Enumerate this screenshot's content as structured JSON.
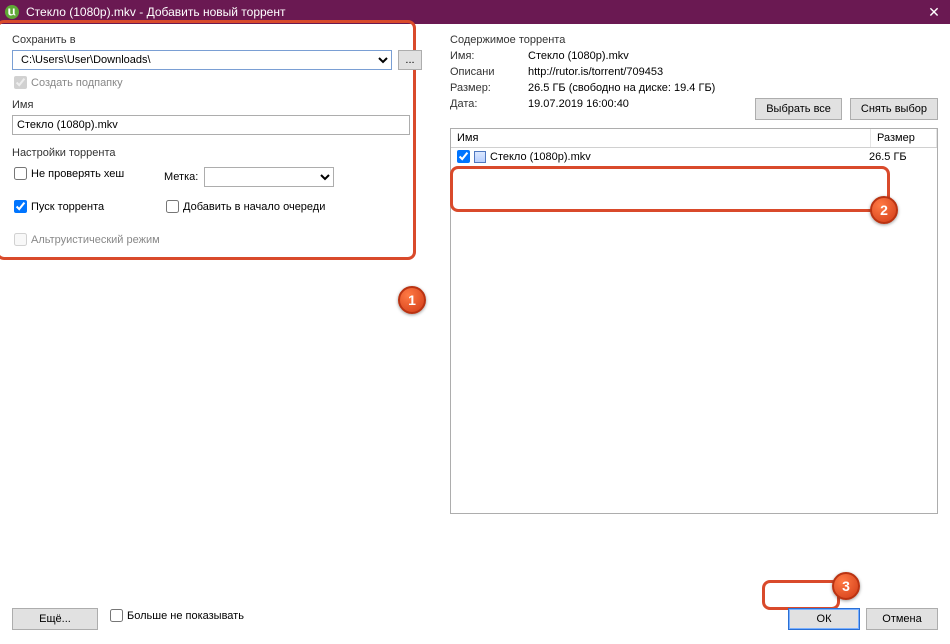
{
  "titlebar": {
    "title": "Стекло (1080p).mkv - Добавить новый торрент",
    "close": "✕"
  },
  "left": {
    "save_in_label": "Сохранить в",
    "path_value": "C:\\Users\\User\\Downloads\\",
    "browse": "...",
    "create_subfolder": "Создать подпапку",
    "name_label": "Имя",
    "name_value": "Стекло (1080p).mkv",
    "torrent_settings_label": "Настройки торрента",
    "skip_hash": "Не проверять хеш",
    "start_torrent": "Пуск торрента",
    "altruistic": "Альтруистический режим",
    "label_label": "Метка:",
    "add_to_top": "Добавить в начало очереди"
  },
  "right": {
    "contents_label": "Содержимое торрента",
    "name_l": "Имя:",
    "name_v": "Стекло (1080p).mkv",
    "desc_l": "Описани",
    "desc_v": "http://rutor.is/torrent/709453",
    "size_l": "Размер:",
    "size_v": "26.5 ГБ (свободно на диске: 19.4 ГБ)",
    "date_l": "Дата:",
    "date_v": "19.07.2019 16:00:40",
    "select_all": "Выбрать все",
    "deselect": "Снять выбор",
    "col_name": "Имя",
    "col_size": "Размер",
    "file_name": "Стекло (1080p).mkv",
    "file_size": "26.5 ГБ"
  },
  "bottom": {
    "more": "Ещё...",
    "dont_show": "Больше не показывать",
    "ok": "ОК",
    "cancel": "Отмена"
  },
  "badges": {
    "b1": "1",
    "b2": "2",
    "b3": "3"
  }
}
